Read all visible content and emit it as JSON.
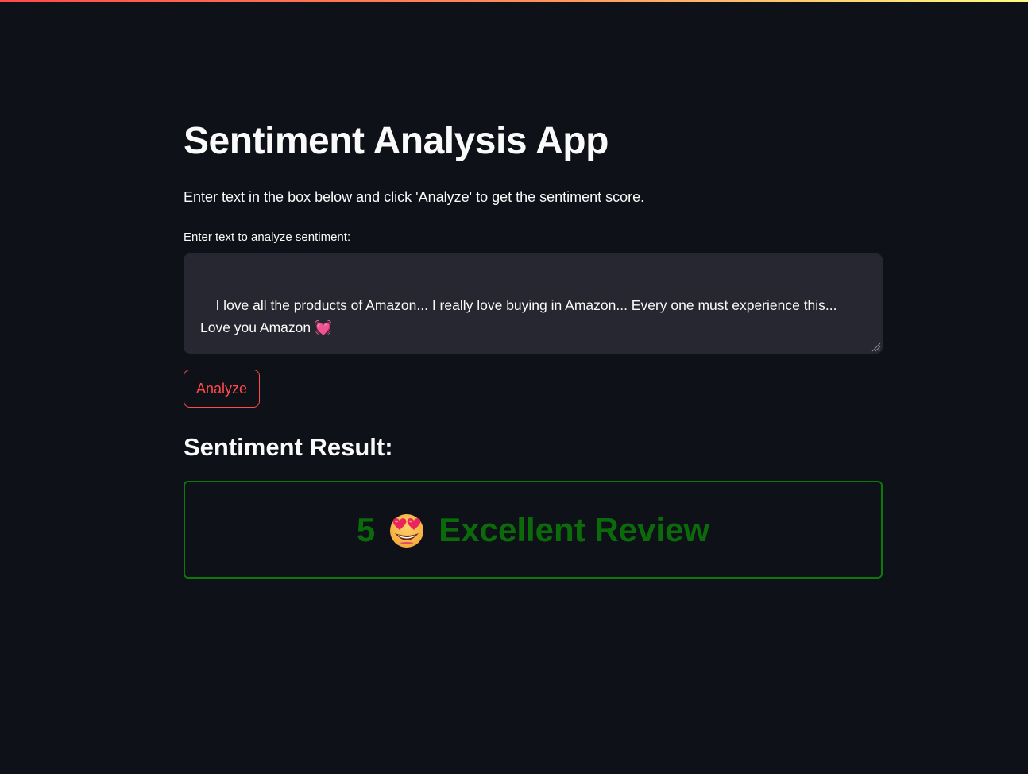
{
  "app": {
    "title": "Sentiment Analysis App",
    "intro": "Enter text in the box below and click 'Analyze' to get the sentiment score."
  },
  "input": {
    "label": "Enter text to analyze sentiment:",
    "value": "I love all the products of Amazon... I really love buying in Amazon... Every one must experience this... Love you Amazon 💓"
  },
  "actions": {
    "analyze_label": "Analyze"
  },
  "result": {
    "heading": "Sentiment Result:",
    "score": "5",
    "icon": "star-struck-face-icon",
    "description": "Excellent Review"
  },
  "colors": {
    "background": "#0e1117",
    "accent": "#ff4b4b",
    "textarea_bg": "#262730",
    "result_border": "#0a7a0a",
    "result_text": "#0b6b0b"
  }
}
